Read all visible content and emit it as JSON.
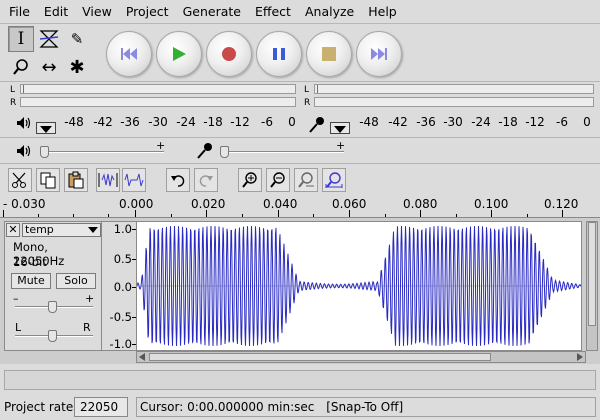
{
  "menu": [
    "File",
    "Edit",
    "View",
    "Project",
    "Generate",
    "Effect",
    "Analyze",
    "Help"
  ],
  "tools": {
    "selection_glyph": "I",
    "draw_glyph": "✎",
    "zoom_glyph": "⚲",
    "timeshift_glyph": "↔",
    "multi_glyph": "✱"
  },
  "meters": {
    "left_label": "L",
    "right_label": "R",
    "scale": [
      "-48",
      "-42",
      "-36",
      "-30",
      "-24",
      "-18",
      "-12",
      "-6",
      "0"
    ]
  },
  "colors": {
    "waveform": "#3a3ad0",
    "waveform_line": "#2b2bc4",
    "transport_glyph_blue": "#8a8ae0",
    "play_green": "#33b033",
    "record_red": "#c84a4a",
    "pause_blue": "#3a5ad8",
    "stop_tan": "#c8b070"
  },
  "ruler": {
    "labels": [
      "- 0.030",
      "0.000",
      "0.020",
      "0.040",
      "0.060",
      "0.080",
      "0.100",
      "0.120"
    ]
  },
  "track": {
    "close_glyph": "✕",
    "name": "temp",
    "format": "Mono, 22050Hz",
    "bitdepth": "16-bit",
    "mute_label": "Mute",
    "solo_label": "Solo",
    "gain_minus": "–",
    "gain_plus": "+",
    "pan_left": "L",
    "pan_right": "R",
    "amplitude_labels": [
      "1.0",
      "0.5",
      "0.0",
      "-0.5",
      "-1.0"
    ]
  },
  "status": {
    "project_rate_label": "Project rate:",
    "project_rate": "22050",
    "cursor_text": "Cursor: 0:00.000000 min:sec",
    "snap_text": "[Snap-To Off]"
  }
}
